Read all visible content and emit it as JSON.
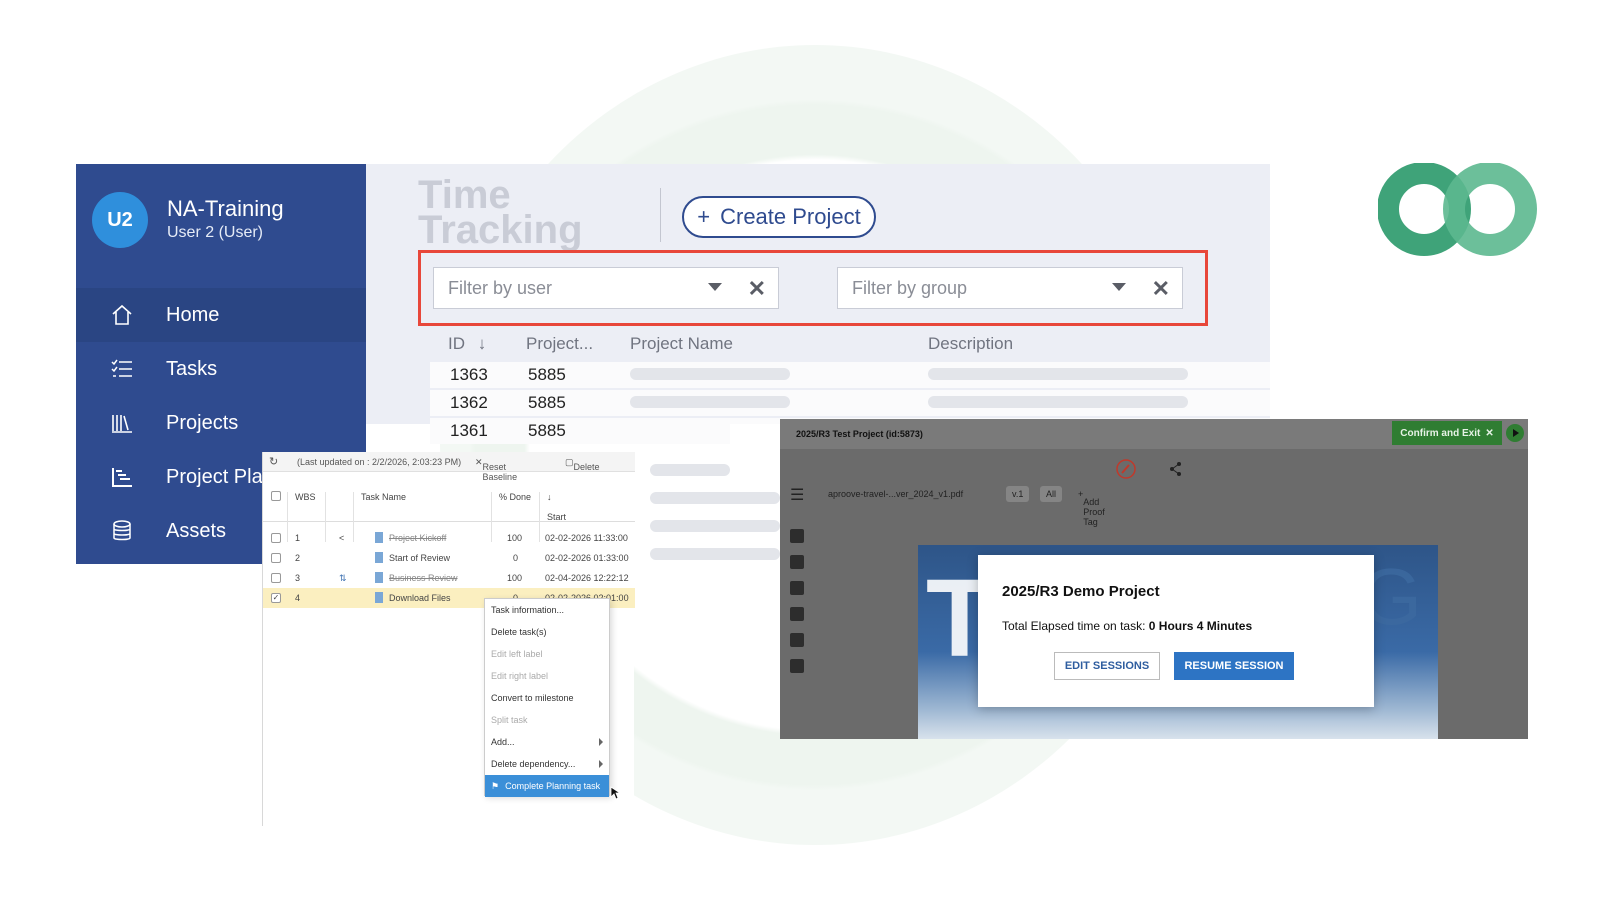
{
  "sidebar": {
    "avatar_initials": "U2",
    "org_name": "NA-Training",
    "user_role": "User 2 (User)",
    "items": [
      {
        "label": "Home",
        "icon": "home-icon",
        "active": true
      },
      {
        "label": "Tasks",
        "icon": "list-icon"
      },
      {
        "label": "Projects",
        "icon": "books-icon"
      },
      {
        "label": "Project Plans",
        "icon": "gantt-icon"
      },
      {
        "label": "Assets",
        "icon": "database-icon"
      }
    ]
  },
  "time_tracking": {
    "title_line1": "Time",
    "title_line2": "Tracking",
    "create_button": "Create Project",
    "filter_user_placeholder": "Filter by user",
    "filter_group_placeholder": "Filter by group",
    "columns": [
      "ID",
      "Project...",
      "Project Name",
      "Description"
    ],
    "rows": [
      {
        "id": "1363",
        "project": "5885"
      },
      {
        "id": "1362",
        "project": "5885"
      },
      {
        "id": "1361",
        "project": "5885"
      }
    ]
  },
  "gantt": {
    "last_updated": "(Last updated on : 2/2/2026, 2:03:23 PM)",
    "reset_baseline": "Reset Baseline",
    "delete": "Delete",
    "columns": {
      "wbs": "WBS",
      "task_name": "Task Name",
      "percent_done": "% Done",
      "start": "Start"
    },
    "rows": [
      {
        "wbs": "1",
        "name": "Project Kickoff",
        "done": "100",
        "start": "02-02-2026 11:33:00"
      },
      {
        "wbs": "2",
        "name": "Start of Review",
        "done": "0",
        "start": "02-02-2026 01:33:00"
      },
      {
        "wbs": "3",
        "name": "Business Review",
        "done": "100",
        "start": "02-04-2026 12:22:12"
      },
      {
        "wbs": "4",
        "name": "Download Files",
        "done": "0",
        "start": "02-02-2026 02:01:00"
      }
    ],
    "context_menu": [
      "Task information...",
      "Delete task(s)",
      "Edit left label",
      "Edit right label",
      "Convert to milestone",
      "Split task",
      "Add...",
      "Delete dependency...",
      "Complete Planning task"
    ]
  },
  "viewer": {
    "title": "2025/R3 Test Project (id:5873)",
    "confirm_button": "Confirm and Exit",
    "file_name": "aproove-travel-...ver_2024_v1.pdf",
    "version": "v.1",
    "filter_all": "All",
    "add_proof_tag": "Add Proof Tag",
    "modal": {
      "title": "2025/R3 Demo Project",
      "elapsed_label": "Total Elapsed time on task:",
      "elapsed_value": "0 Hours 4 Minutes",
      "edit_button": "EDIT SESSIONS",
      "resume_button": "RESUME SESSION"
    }
  },
  "colors": {
    "sidebar": "#2f4b8f",
    "avatar": "#2f8fdc",
    "filter_highlight": "#e8473a",
    "confirm_green": "#2f7d32",
    "logo_green": "#3fa379",
    "resume_blue": "#2d74c4"
  }
}
